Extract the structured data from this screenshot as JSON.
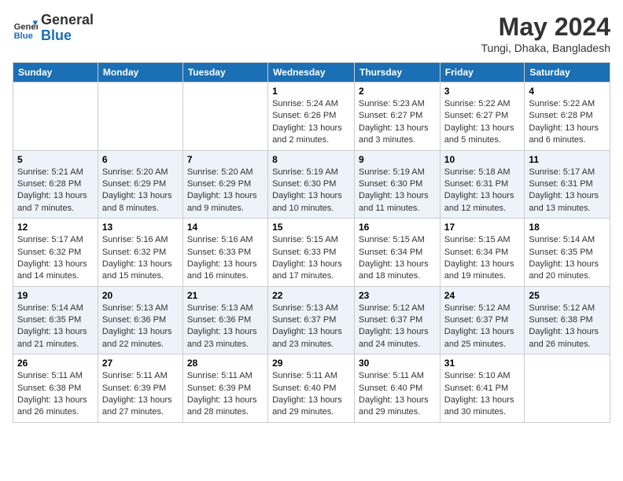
{
  "logo": {
    "text_general": "General",
    "text_blue": "Blue"
  },
  "title": "May 2024",
  "location": "Tungi, Dhaka, Bangladesh",
  "days_of_week": [
    "Sunday",
    "Monday",
    "Tuesday",
    "Wednesday",
    "Thursday",
    "Friday",
    "Saturday"
  ],
  "weeks": [
    {
      "cells": [
        {
          "day": "",
          "empty": true
        },
        {
          "day": "",
          "empty": true
        },
        {
          "day": "",
          "empty": true
        },
        {
          "day": "1",
          "sunrise": "5:24 AM",
          "sunset": "6:26 PM",
          "daylight": "13 hours and 2 minutes."
        },
        {
          "day": "2",
          "sunrise": "5:23 AM",
          "sunset": "6:27 PM",
          "daylight": "13 hours and 3 minutes."
        },
        {
          "day": "3",
          "sunrise": "5:22 AM",
          "sunset": "6:27 PM",
          "daylight": "13 hours and 5 minutes."
        },
        {
          "day": "4",
          "sunrise": "5:22 AM",
          "sunset": "6:28 PM",
          "daylight": "13 hours and 6 minutes."
        }
      ]
    },
    {
      "cells": [
        {
          "day": "5",
          "sunrise": "5:21 AM",
          "sunset": "6:28 PM",
          "daylight": "13 hours and 7 minutes."
        },
        {
          "day": "6",
          "sunrise": "5:20 AM",
          "sunset": "6:29 PM",
          "daylight": "13 hours and 8 minutes."
        },
        {
          "day": "7",
          "sunrise": "5:20 AM",
          "sunset": "6:29 PM",
          "daylight": "13 hours and 9 minutes."
        },
        {
          "day": "8",
          "sunrise": "5:19 AM",
          "sunset": "6:30 PM",
          "daylight": "13 hours and 10 minutes."
        },
        {
          "day": "9",
          "sunrise": "5:19 AM",
          "sunset": "6:30 PM",
          "daylight": "13 hours and 11 minutes."
        },
        {
          "day": "10",
          "sunrise": "5:18 AM",
          "sunset": "6:31 PM",
          "daylight": "13 hours and 12 minutes."
        },
        {
          "day": "11",
          "sunrise": "5:17 AM",
          "sunset": "6:31 PM",
          "daylight": "13 hours and 13 minutes."
        }
      ]
    },
    {
      "cells": [
        {
          "day": "12",
          "sunrise": "5:17 AM",
          "sunset": "6:32 PM",
          "daylight": "13 hours and 14 minutes."
        },
        {
          "day": "13",
          "sunrise": "5:16 AM",
          "sunset": "6:32 PM",
          "daylight": "13 hours and 15 minutes."
        },
        {
          "day": "14",
          "sunrise": "5:16 AM",
          "sunset": "6:33 PM",
          "daylight": "13 hours and 16 minutes."
        },
        {
          "day": "15",
          "sunrise": "5:15 AM",
          "sunset": "6:33 PM",
          "daylight": "13 hours and 17 minutes."
        },
        {
          "day": "16",
          "sunrise": "5:15 AM",
          "sunset": "6:34 PM",
          "daylight": "13 hours and 18 minutes."
        },
        {
          "day": "17",
          "sunrise": "5:15 AM",
          "sunset": "6:34 PM",
          "daylight": "13 hours and 19 minutes."
        },
        {
          "day": "18",
          "sunrise": "5:14 AM",
          "sunset": "6:35 PM",
          "daylight": "13 hours and 20 minutes."
        }
      ]
    },
    {
      "cells": [
        {
          "day": "19",
          "sunrise": "5:14 AM",
          "sunset": "6:35 PM",
          "daylight": "13 hours and 21 minutes."
        },
        {
          "day": "20",
          "sunrise": "5:13 AM",
          "sunset": "6:36 PM",
          "daylight": "13 hours and 22 minutes."
        },
        {
          "day": "21",
          "sunrise": "5:13 AM",
          "sunset": "6:36 PM",
          "daylight": "13 hours and 23 minutes."
        },
        {
          "day": "22",
          "sunrise": "5:13 AM",
          "sunset": "6:37 PM",
          "daylight": "13 hours and 23 minutes."
        },
        {
          "day": "23",
          "sunrise": "5:12 AM",
          "sunset": "6:37 PM",
          "daylight": "13 hours and 24 minutes."
        },
        {
          "day": "24",
          "sunrise": "5:12 AM",
          "sunset": "6:37 PM",
          "daylight": "13 hours and 25 minutes."
        },
        {
          "day": "25",
          "sunrise": "5:12 AM",
          "sunset": "6:38 PM",
          "daylight": "13 hours and 26 minutes."
        }
      ]
    },
    {
      "cells": [
        {
          "day": "26",
          "sunrise": "5:11 AM",
          "sunset": "6:38 PM",
          "daylight": "13 hours and 26 minutes."
        },
        {
          "day": "27",
          "sunrise": "5:11 AM",
          "sunset": "6:39 PM",
          "daylight": "13 hours and 27 minutes."
        },
        {
          "day": "28",
          "sunrise": "5:11 AM",
          "sunset": "6:39 PM",
          "daylight": "13 hours and 28 minutes."
        },
        {
          "day": "29",
          "sunrise": "5:11 AM",
          "sunset": "6:40 PM",
          "daylight": "13 hours and 29 minutes."
        },
        {
          "day": "30",
          "sunrise": "5:11 AM",
          "sunset": "6:40 PM",
          "daylight": "13 hours and 29 minutes."
        },
        {
          "day": "31",
          "sunrise": "5:10 AM",
          "sunset": "6:41 PM",
          "daylight": "13 hours and 30 minutes."
        },
        {
          "day": "",
          "empty": true
        }
      ]
    }
  ]
}
